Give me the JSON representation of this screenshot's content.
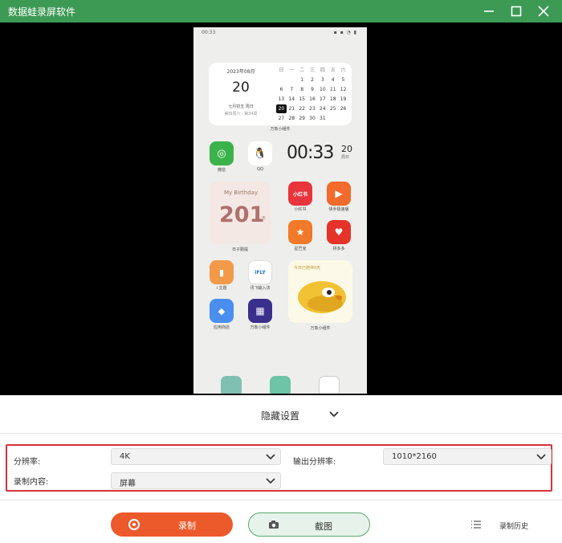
{
  "window": {
    "title": "数据蛙录屏软件"
  },
  "phone": {
    "status_time": "00:33",
    "status_icons": "▪ ▪ ◔ ▮",
    "calendar": {
      "year_month": "2023年08月",
      "day": "20",
      "lunar": "七月初五  周日",
      "info": "第四周六 · 第34周",
      "weekday_headers": [
        "日",
        "一",
        "二",
        "三",
        "四",
        "五",
        "六"
      ],
      "rows": [
        [
          "",
          "",
          "1",
          "2",
          "3",
          "4",
          "5"
        ],
        [
          "6",
          "7",
          "8",
          "9",
          "10",
          "11",
          "12"
        ],
        [
          "13",
          "14",
          "15",
          "16",
          "17",
          "18",
          "19"
        ],
        [
          "20",
          "21",
          "22",
          "23",
          "24",
          "25",
          "26"
        ],
        [
          "27",
          "28",
          "29",
          "30",
          "31",
          "",
          ""
        ]
      ],
      "label": "万象小组件"
    },
    "apps_row1": [
      {
        "name": "微信",
        "color": "#3cb34a",
        "glyph": "◎"
      },
      {
        "name": "QQ",
        "color": "#ffffff",
        "glyph": "🐧"
      }
    ],
    "clock": {
      "time": "00:33",
      "day": "20",
      "sub": "周日"
    },
    "birthday": {
      "title": "My Birthday",
      "number": "201",
      "unit": "天",
      "label": "日子勤提"
    },
    "apps_right1": [
      {
        "name": "小红书",
        "color": "#e8343c",
        "glyph": "小红书"
      },
      {
        "name": "快手极速版",
        "color": "#f26a2c",
        "glyph": "▶"
      }
    ],
    "apps_right2": [
      {
        "name": "星巴克",
        "color": "#f07a2a",
        "glyph": "★"
      },
      {
        "name": "拼多多",
        "color": "#e6332a",
        "glyph": "♥"
      }
    ],
    "apps_row3": [
      {
        "name": "i 主题",
        "color": "#f29a4a",
        "glyph": "▮"
      },
      {
        "name": "讯飞输入法",
        "color": "#ffffff",
        "glyph": "iFLY"
      }
    ],
    "apps_row4": [
      {
        "name": "应用商店",
        "color": "#4a8ef0",
        "glyph": "◆"
      },
      {
        "name": "万象小组件",
        "color": "#3a2f8c",
        "glyph": "▦"
      }
    ],
    "bird_widget": {
      "title": "今日已陪伴0天",
      "label": "万象小组件"
    }
  },
  "settings": {
    "toggle_label": "隐藏设置",
    "resolution_label": "分辨率:",
    "resolution_value": "4K",
    "output_resolution_label": "输出分辨率:",
    "output_resolution_value": "1010*2160",
    "content_label": "录制内容:",
    "content_value": "屏幕"
  },
  "toolbar": {
    "record_label": "录制",
    "screenshot_label": "截图",
    "history_label": "录制历史"
  },
  "colors": {
    "titlebar": "#3c9a55",
    "record": "#ec5a2b",
    "highlight": "#d6323c"
  }
}
